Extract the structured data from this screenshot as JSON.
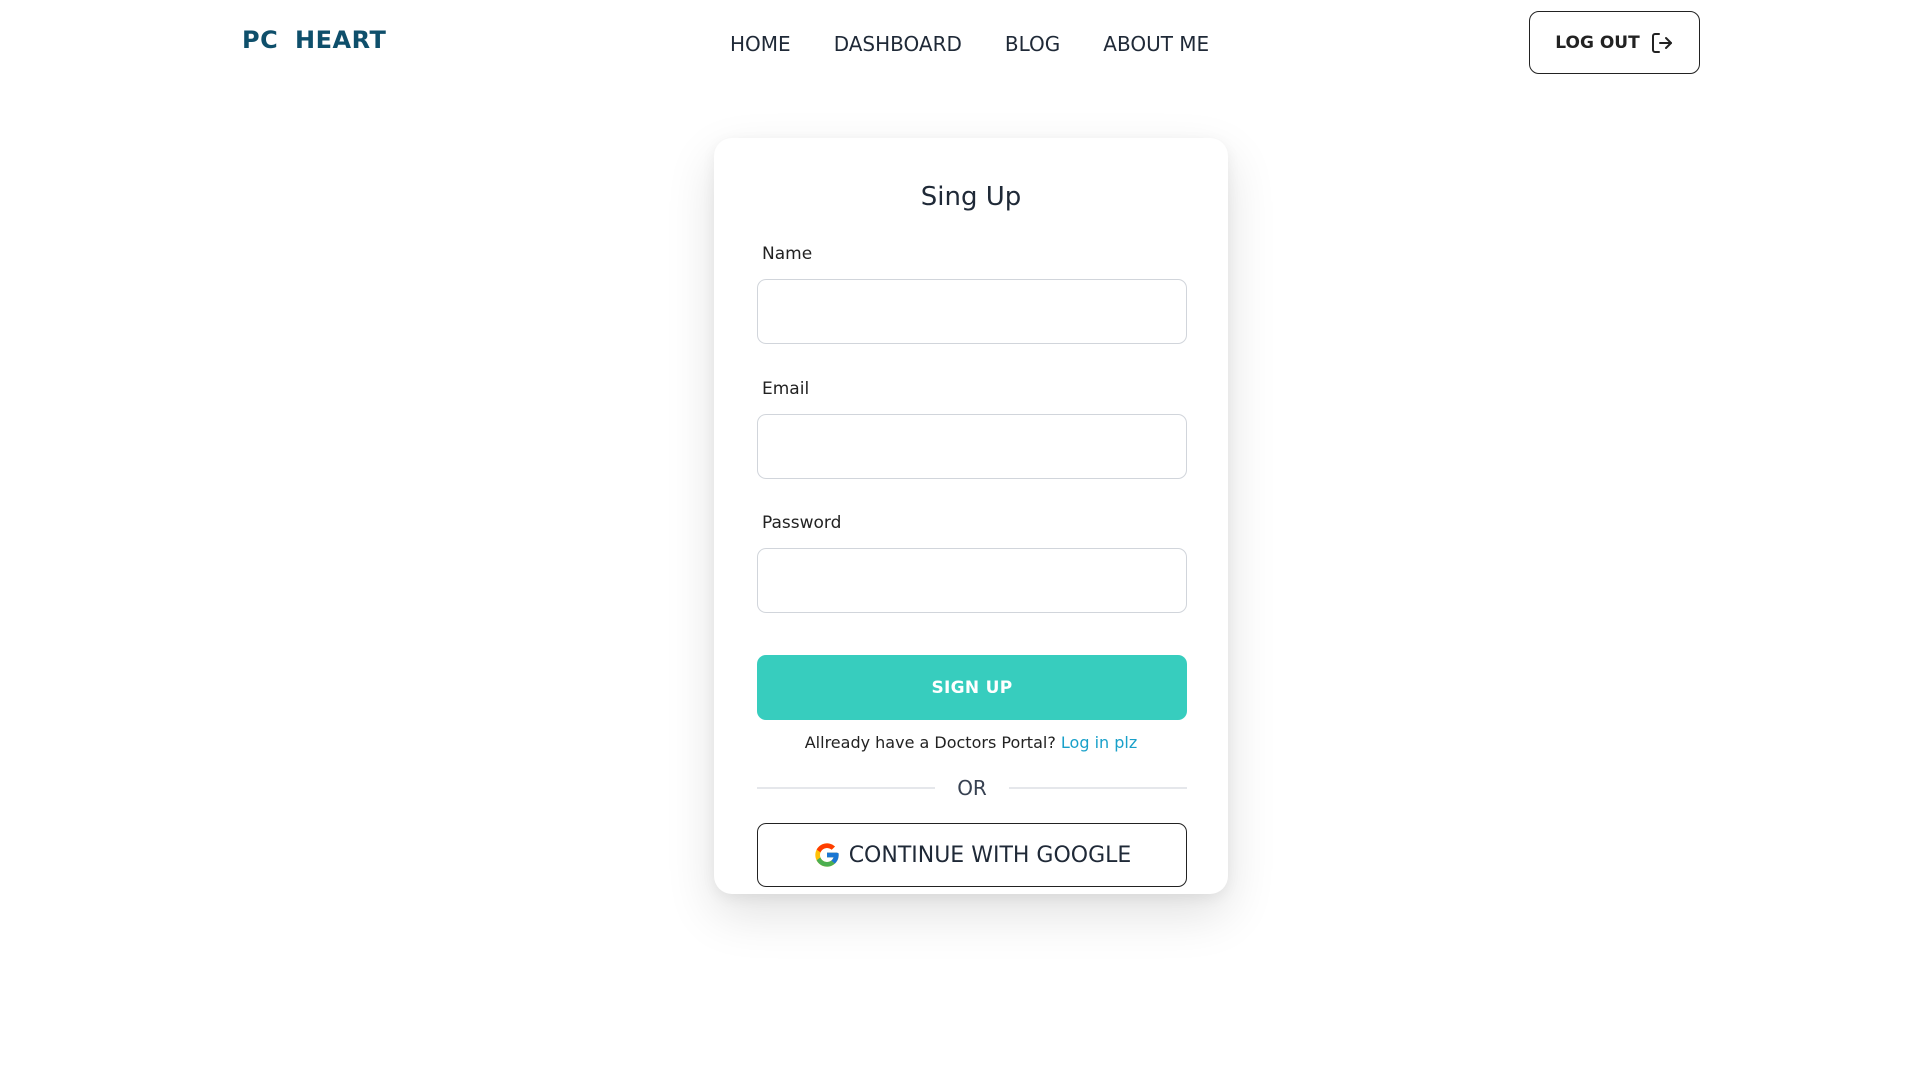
{
  "header": {
    "brand": "PC  HEART",
    "nav": [
      "HOME",
      "DASHBOARD",
      "BLOG",
      "ABOUT ME"
    ],
    "logout_label": "LOG OUT",
    "logout_icon": "logout-arrow-icon"
  },
  "form": {
    "title": "Sing Up",
    "fields": {
      "name": {
        "label": "Name",
        "value": "",
        "placeholder": ""
      },
      "email": {
        "label": "Email",
        "value": "",
        "placeholder": ""
      },
      "password": {
        "label": "Password",
        "value": "",
        "placeholder": ""
      }
    },
    "submit_label": "SIGN UP",
    "already_text": "Allready have a Doctors Portal?",
    "login_link": "Log in plz",
    "divider": "OR",
    "google_label": "CONTINUE WITH GOOGLE",
    "google_icon": "google-g-icon"
  },
  "colors": {
    "brand": "#0e4f6b",
    "accent": "#37cdbe",
    "link": "#19a0c9"
  }
}
